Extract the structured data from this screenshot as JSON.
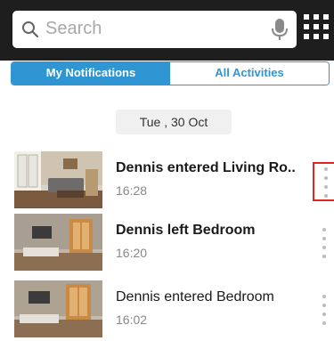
{
  "search": {
    "placeholder": "Search",
    "icon": "search-icon",
    "mic_icon": "microphone-icon"
  },
  "grid_icon": "apps-grid-icon",
  "tabs": [
    {
      "label": "My Notifications",
      "active": true
    },
    {
      "label": "All Activities",
      "active": false
    }
  ],
  "date_header": "Tue , 30 Oct",
  "notifications": [
    {
      "title": "Dennis entered Living Ro..",
      "time": "16:28",
      "more_icon": "more-vertical-icon",
      "highlighted": true
    },
    {
      "title": "Dennis left Bedroom",
      "time": "16:20",
      "more_icon": "more-vertical-icon",
      "highlighted": false
    },
    {
      "title": "Dennis entered Bedroom",
      "time": "16:02",
      "more_icon": "more-vertical-icon",
      "highlighted": false
    }
  ],
  "colors": {
    "accent": "#2f96d3",
    "highlight": "#e02424",
    "topbar": "#1e1e1e"
  }
}
